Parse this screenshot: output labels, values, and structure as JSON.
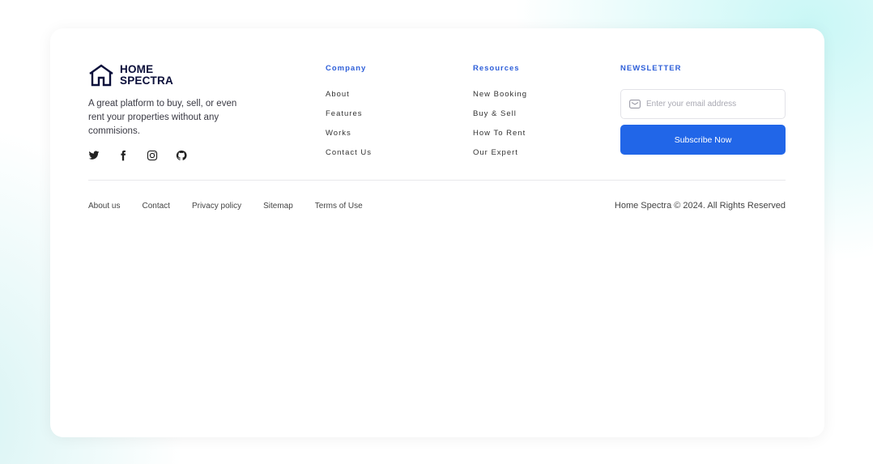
{
  "brand": {
    "name_line1": "HOME",
    "name_line2": "SPECTRA",
    "description": "A great platform to buy, sell, or even rent your properties without any commisions.",
    "logo_icon": "house-outline-icon"
  },
  "socials": [
    {
      "icon": "twitter-icon"
    },
    {
      "icon": "facebook-icon"
    },
    {
      "icon": "instagram-icon"
    },
    {
      "icon": "github-icon"
    }
  ],
  "company": {
    "title": "Company",
    "links": [
      "About",
      "Features",
      "Works",
      "Contact Us"
    ]
  },
  "resources": {
    "title": "Resources",
    "links": [
      "New Booking",
      "Buy & Sell",
      "How To Rent",
      "Our Expert"
    ]
  },
  "newsletter": {
    "title": "NEWSLETTER",
    "email_placeholder": "Enter your email address",
    "email_value": "",
    "subscribe_label": "Subscribe Now",
    "button_color": "#2166e8"
  },
  "bottom_links": [
    "About us",
    "Contact",
    "Privacy policy",
    "Sitemap",
    "Terms of Use"
  ],
  "copyright": "Home Spectra © 2024. All Rights Reserved",
  "colors": {
    "accent": "#2e5fd9",
    "brand_dark": "#0b0f3a"
  }
}
